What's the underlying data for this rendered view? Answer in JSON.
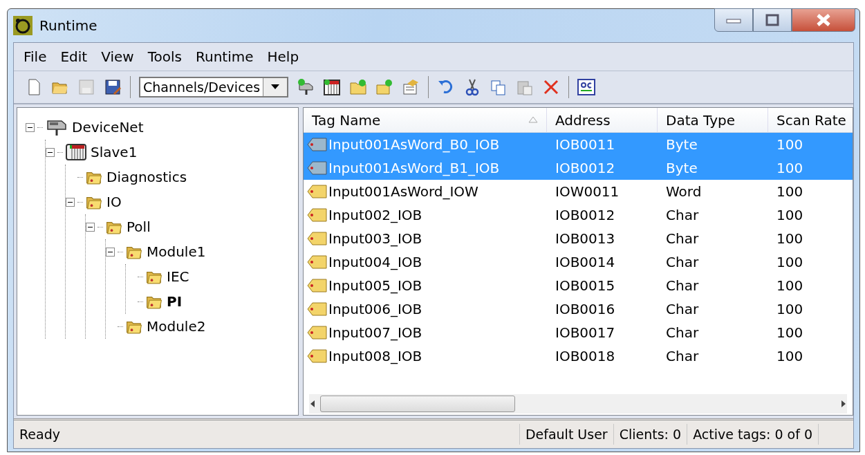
{
  "window": {
    "title": "Runtime"
  },
  "menu": [
    "File",
    "Edit",
    "View",
    "Tools",
    "Runtime",
    "Help"
  ],
  "toolbar": {
    "view_select": "Channels/Devices"
  },
  "tree": [
    {
      "label": "DeviceNet",
      "kind": "network",
      "expanded": true,
      "selected": false,
      "children": [
        {
          "label": "Slave1",
          "kind": "device",
          "expanded": true,
          "selected": false,
          "children": [
            {
              "label": "Diagnostics",
              "kind": "folder",
              "selected": false
            },
            {
              "label": "IO",
              "kind": "folder",
              "expanded": true,
              "selected": false,
              "children": [
                {
                  "label": "Poll",
                  "kind": "folder",
                  "expanded": true,
                  "selected": false,
                  "children": [
                    {
                      "label": "Module1",
                      "kind": "folder",
                      "expanded": true,
                      "selected": false,
                      "children": [
                        {
                          "label": "IEC",
                          "kind": "folder",
                          "selected": false
                        },
                        {
                          "label": "PI",
                          "kind": "folder",
                          "selected": true
                        }
                      ]
                    },
                    {
                      "label": "Module2",
                      "kind": "folder",
                      "selected": false
                    }
                  ]
                }
              ]
            }
          ]
        }
      ]
    }
  ],
  "table": {
    "columns": [
      "Tag Name",
      "Address",
      "Data Type",
      "Scan Rate"
    ],
    "rows": [
      {
        "cells": [
          "Input001AsWord_B0_IOB",
          "IOB0011",
          "Byte",
          "100"
        ],
        "selected": true
      },
      {
        "cells": [
          "Input001AsWord_B1_IOB",
          "IOB0012",
          "Byte",
          "100"
        ],
        "selected": true
      },
      {
        "cells": [
          "Input001AsWord_IOW",
          "IOW0011",
          "Word",
          "100"
        ],
        "selected": false
      },
      {
        "cells": [
          "Input002_IOB",
          "IOB0012",
          "Char",
          "100"
        ],
        "selected": false
      },
      {
        "cells": [
          "Input003_IOB",
          "IOB0013",
          "Char",
          "100"
        ],
        "selected": false
      },
      {
        "cells": [
          "Input004_IOB",
          "IOB0014",
          "Char",
          "100"
        ],
        "selected": false
      },
      {
        "cells": [
          "Input005_IOB",
          "IOB0015",
          "Char",
          "100"
        ],
        "selected": false
      },
      {
        "cells": [
          "Input006_IOB",
          "IOB0016",
          "Char",
          "100"
        ],
        "selected": false
      },
      {
        "cells": [
          "Input007_IOB",
          "IOB0017",
          "Char",
          "100"
        ],
        "selected": false
      },
      {
        "cells": [
          "Input008_IOB",
          "IOB0018",
          "Char",
          "100"
        ],
        "selected": false
      }
    ]
  },
  "status_bar": [
    "Ready",
    "Default User",
    "Clients:  0",
    "Active tags:  0 of 0"
  ]
}
